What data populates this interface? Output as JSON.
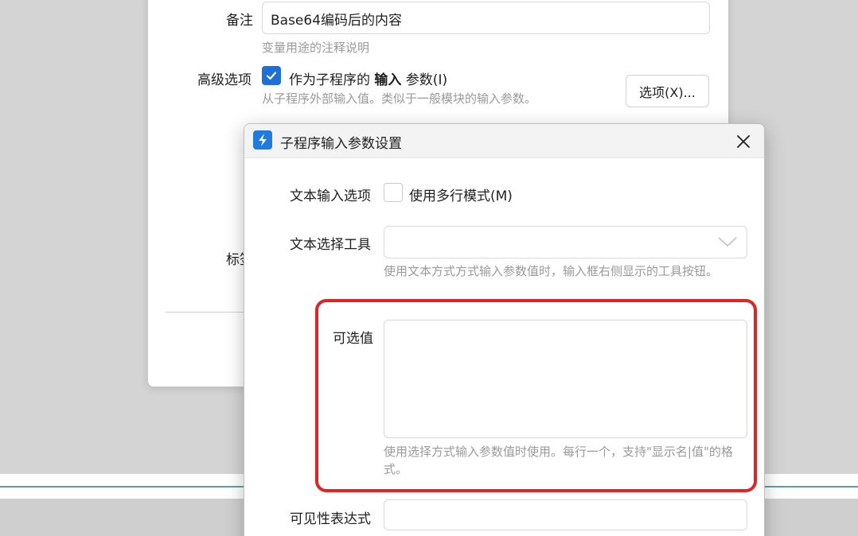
{
  "background_dialog": {
    "remark_label": "备注",
    "remark_value": "Base64编码后的内容",
    "remark_hint": "变量用途的注释说明",
    "advanced_label": "高级选项",
    "advanced_checkbox_text_pre": "作为子程序的 ",
    "advanced_checkbox_text_bold": "输入",
    "advanced_checkbox_text_post": " 参数(I)",
    "advanced_checked": true,
    "advanced_hint": "从子程序外部输入值。类似于一般模块的输入参数。",
    "options_button": "选项(X)...",
    "partial_label": "标签"
  },
  "dialog": {
    "title": "子程序输入参数设置",
    "text_input_option_label": "文本输入选项",
    "multiline_checkbox_label": "使用多行模式(M)",
    "multiline_checked": false,
    "text_select_tool_label": "文本选择工具",
    "text_select_tool_value": "",
    "text_select_tool_hint": "使用文本方式方式输入参数值时，输入框右侧显示的工具按钮。",
    "optional_values_label": "可选值",
    "optional_values_value": "",
    "optional_values_hint": "使用选择方式输入参数值时使用。每行一个，支持\"显示名|值\"的格式。",
    "visibility_label": "可见性表达式",
    "visibility_value": ""
  },
  "icons": {
    "app": "app-logo-icon",
    "close": "close-icon",
    "check": "check-icon",
    "chevron": "chevron-down-icon"
  },
  "colors": {
    "accent": "#1e6fd9",
    "highlight": "#e02424",
    "hint_text": "#9a9a9a"
  }
}
